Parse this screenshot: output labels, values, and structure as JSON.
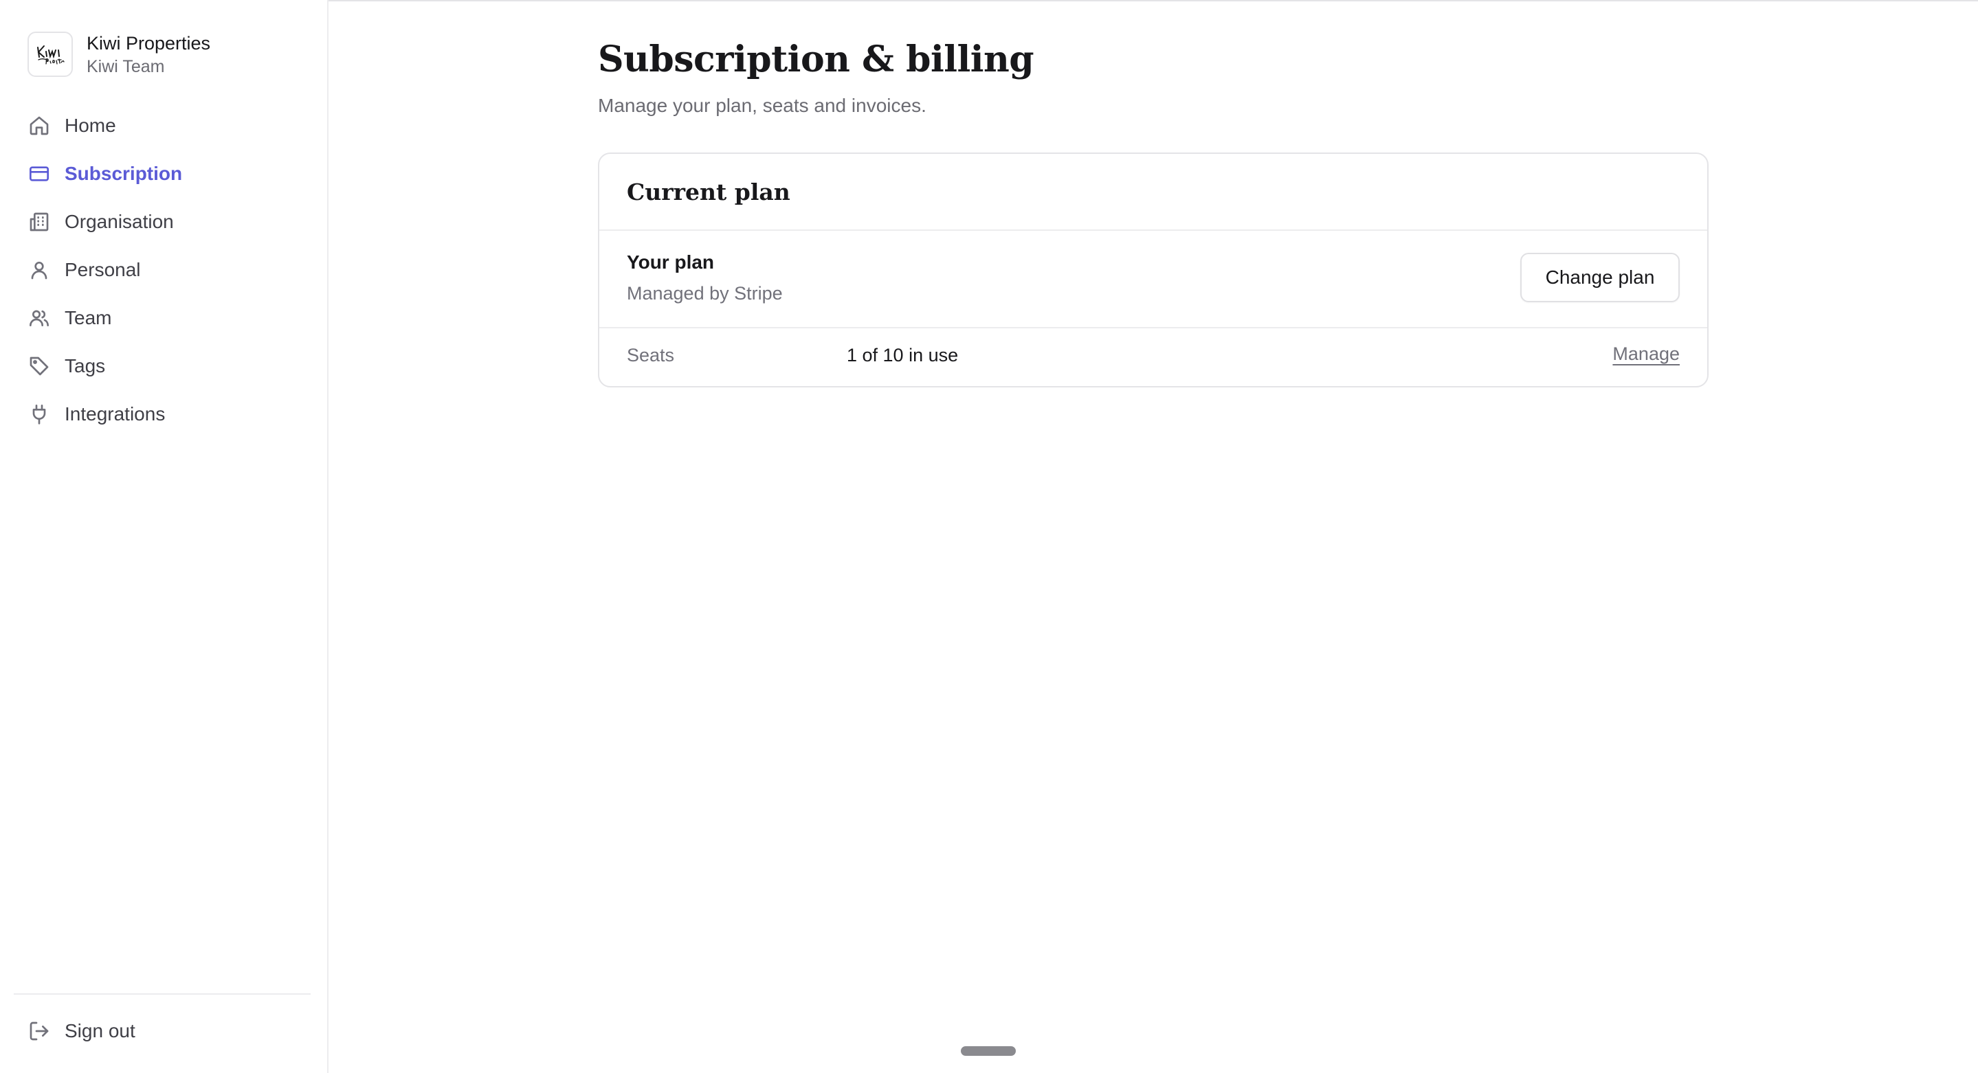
{
  "org": {
    "name": "Kiwi Properties",
    "team": "Kiwi Team",
    "logo_text": "Kiwi Properties"
  },
  "sidebar": {
    "items": [
      {
        "label": "Home",
        "icon": "home-icon",
        "active": false
      },
      {
        "label": "Subscription",
        "icon": "credit-card-icon",
        "active": true
      },
      {
        "label": "Organisation",
        "icon": "building-icon",
        "active": false
      },
      {
        "label": "Personal",
        "icon": "user-icon",
        "active": false
      },
      {
        "label": "Team",
        "icon": "users-icon",
        "active": false
      },
      {
        "label": "Tags",
        "icon": "tag-icon",
        "active": false
      },
      {
        "label": "Integrations",
        "icon": "plug-icon",
        "active": false
      }
    ],
    "sign_out": {
      "label": "Sign out",
      "icon": "log-out-icon"
    }
  },
  "page": {
    "title": "Subscription & billing",
    "subtitle": "Manage your plan, seats and invoices."
  },
  "card": {
    "title": "Current plan",
    "plan_label": "Your plan",
    "plan_desc": "Managed by Stripe",
    "change_plan": "Change plan",
    "seats_label": "Seats",
    "seats_value": "1 of 10 in use",
    "manage": "Manage"
  },
  "colors": {
    "accent": "#5b5bd6",
    "text": "#18181b",
    "muted": "#71717a",
    "border": "#e4e4e7"
  }
}
